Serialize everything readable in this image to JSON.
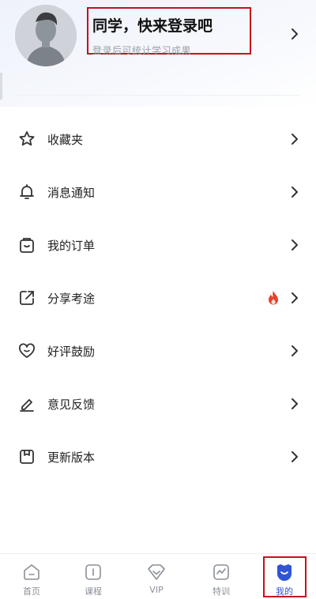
{
  "profile": {
    "title": "同学，快来登录吧",
    "subtitle": "登录后可统计学习成果",
    "avatar_icon": "default-avatar",
    "chevron_icon": "chevron-right-icon"
  },
  "menu": {
    "items": [
      {
        "label": "收藏夹",
        "icon": "star-icon"
      },
      {
        "label": "消息通知",
        "icon": "bell-icon"
      },
      {
        "label": "我的订单",
        "icon": "order-bag-icon"
      },
      {
        "label": "分享考途",
        "icon": "share-icon",
        "badge": "fire-icon"
      },
      {
        "label": "好评鼓励",
        "icon": "heart-icon"
      },
      {
        "label": "意见反馈",
        "icon": "pen-icon"
      },
      {
        "label": "更新版本",
        "icon": "update-icon"
      }
    ]
  },
  "tabbar": {
    "tabs": [
      {
        "label": "首页",
        "icon": "home-icon",
        "active": false
      },
      {
        "label": "课程",
        "icon": "course-icon",
        "active": false
      },
      {
        "label": "VIP",
        "icon": "vip-icon",
        "active": false
      },
      {
        "label": "特训",
        "icon": "training-icon",
        "active": false
      },
      {
        "label": "我的",
        "icon": "mine-icon",
        "active": true
      }
    ]
  },
  "colors": {
    "accent": "#2f55d4",
    "highlight_border": "#c8101e",
    "fire": "#e8412c",
    "text": "#222222",
    "muted": "#9aa0aa",
    "icon_gray": "#8a8f98"
  }
}
